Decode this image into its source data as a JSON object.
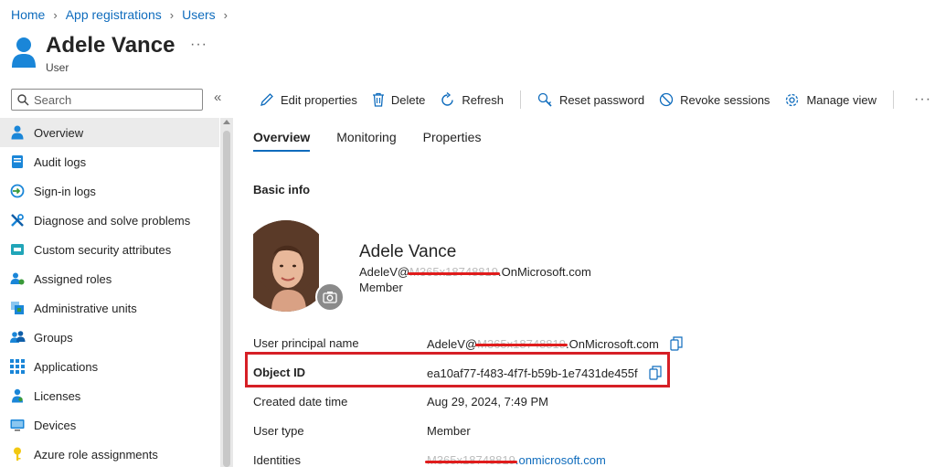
{
  "breadcrumb": {
    "items": [
      "Home",
      "App registrations",
      "Users"
    ]
  },
  "header": {
    "title": "Adele Vance",
    "subtitle": "User",
    "more": "···"
  },
  "search": {
    "placeholder": "Search",
    "collapse": "«"
  },
  "sidebar": {
    "items": [
      {
        "label": "Overview",
        "icon": "user-icon",
        "active": true
      },
      {
        "label": "Audit logs",
        "icon": "audit-log-icon"
      },
      {
        "label": "Sign-in logs",
        "icon": "sign-in-icon"
      },
      {
        "label": "Diagnose and solve problems",
        "icon": "wrench-icon"
      },
      {
        "label": "Custom security attributes",
        "icon": "attributes-icon"
      },
      {
        "label": "Assigned roles",
        "icon": "roles-icon"
      },
      {
        "label": "Administrative units",
        "icon": "admin-units-icon"
      },
      {
        "label": "Groups",
        "icon": "groups-icon"
      },
      {
        "label": "Applications",
        "icon": "apps-grid-icon"
      },
      {
        "label": "Licenses",
        "icon": "license-icon"
      },
      {
        "label": "Devices",
        "icon": "device-icon"
      },
      {
        "label": "Azure role assignments",
        "icon": "key-icon"
      }
    ]
  },
  "toolbar": {
    "edit": "Edit properties",
    "delete": "Delete",
    "refresh": "Refresh",
    "reset_password": "Reset password",
    "revoke_sessions": "Revoke sessions",
    "manage_view": "Manage view",
    "more": "···"
  },
  "tabs": [
    "Overview",
    "Monitoring",
    "Properties"
  ],
  "basic_info": {
    "title": "Basic info",
    "name": "Adele Vance",
    "email_prefix": "AdeleV@",
    "email_redacted": "M365x18748819",
    "email_suffix": ".OnMicrosoft.com",
    "member_type": "Member"
  },
  "properties": {
    "upn_label": "User principal name",
    "upn_prefix": "AdeleV@",
    "upn_redacted": "M365x18748819",
    "upn_suffix": ".OnMicrosoft.com",
    "object_id_label": "Object ID",
    "object_id": "ea10af77-f483-4f7f-b59b-1e7431de455f",
    "created_label": "Created date time",
    "created": "Aug 29, 2024, 7:49 PM",
    "user_type_label": "User type",
    "user_type": "Member",
    "identities_label": "Identities",
    "identities_redacted": "M365x18748819",
    "identities_suffix": ".onmicrosoft.com"
  },
  "colors": {
    "accent": "#0f6cbd",
    "highlight": "#d61f26",
    "redaction": "#e01c1c"
  }
}
